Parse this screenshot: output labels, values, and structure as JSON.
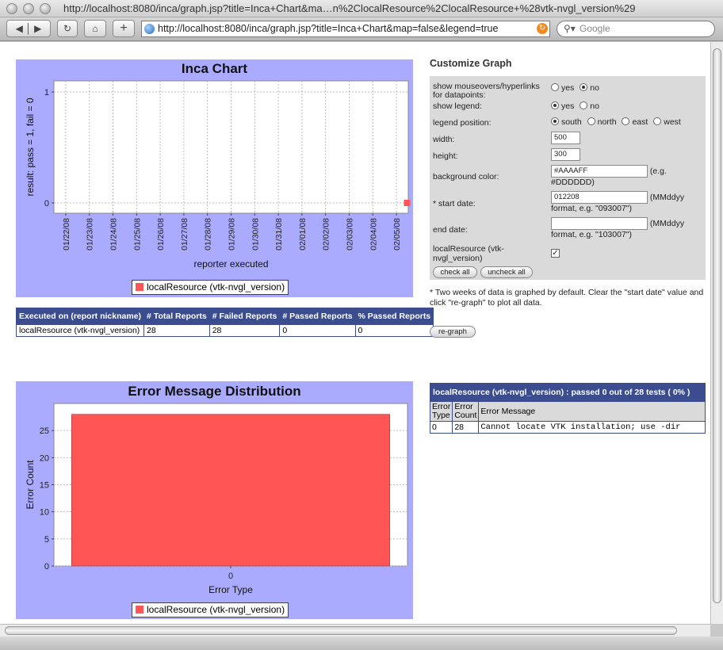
{
  "window": {
    "title": "http://localhost:8080/inca/graph.jsp?title=Inca+Chart&ma…n%2ClocalResource%2ClocalResource+%28vtk-nvgl_version%29",
    "url": "http://localhost:8080/inca/graph.jsp?title=Inca+Chart&map=false&legend=true",
    "search_placeholder": "Google"
  },
  "inca_chart": {
    "title": "Inca Chart",
    "legend": "localResource (vtk-nvgl_version)",
    "chart_data": {
      "type": "scatter",
      "title": "Inca Chart",
      "xlabel": "reporter executed",
      "ylabel": "result: pass = 1, fail = 0",
      "x_ticks": [
        "01/22/08",
        "01/23/08",
        "01/24/08",
        "01/25/08",
        "01/26/08",
        "01/27/08",
        "01/28/08",
        "01/29/08",
        "01/30/08",
        "01/31/08",
        "02/01/08",
        "02/02/08",
        "02/03/08",
        "02/04/08",
        "02/05/08"
      ],
      "y_ticks": [
        "0",
        "1"
      ],
      "ylim": [
        0,
        1
      ],
      "series": [
        {
          "name": "localResource (vtk-nvgl_version)",
          "x": [
            "02/05/08"
          ],
          "y": [
            0
          ]
        }
      ],
      "color": "#ff5555",
      "grid": true,
      "legend_position": "bottom"
    }
  },
  "summary": {
    "headers": [
      "Executed on (report nickname)",
      "# Total Reports",
      "# Failed Reports",
      "# Passed Reports",
      "% Passed Reports"
    ],
    "row": [
      "localResource (vtk-nvgl_version)",
      "28",
      "28",
      "0",
      "0"
    ]
  },
  "error_chart": {
    "title": "Error Message Distribution",
    "legend": "localResource (vtk-nvgl_version)",
    "chart_data": {
      "type": "bar",
      "title": "Error Message Distribution",
      "categories": [
        "0"
      ],
      "values": [
        28
      ],
      "xlabel": "Error Type",
      "ylabel": "Error Count",
      "y_ticks": [
        "0",
        "5",
        "10",
        "15",
        "20",
        "25"
      ],
      "ylim": [
        0,
        30
      ],
      "series": [
        {
          "name": "localResource (vtk-nvgl_version)",
          "values": [
            28
          ]
        }
      ],
      "color": "#ff5555",
      "grid": true,
      "legend_position": "bottom"
    }
  },
  "customize": {
    "heading": "Customize Graph",
    "mouseovers_label": "show mouseovers/hyperlinks for datapoints:",
    "legend_label": "show legend:",
    "legend_position_label": "legend position:",
    "width_label": "width:",
    "height_label": "height:",
    "bgcolor_label": "background color:",
    "start_label": "* start date:",
    "end_label": "end date:",
    "series_label": "localResource (vtk-nvgl_version)",
    "yes": "yes",
    "no": "no",
    "positions": [
      "south",
      "north",
      "east",
      "west"
    ],
    "width_value": "500",
    "height_value": "300",
    "bgcolor_value": "#AAAAFF",
    "bgcolor_hint": "(e.g. #DDDDDD)",
    "start_value": "012208",
    "start_hint": "(MMddyy format, e.g. \"093007\")",
    "end_value": "",
    "end_hint": "(MMddyy format, e.g. \"103007\")",
    "check_all": "check all",
    "uncheck_all": "uncheck all",
    "note": "* Two weeks of data is graphed by default. Clear the \"start date\" value and click \"re-graph\" to plot all data.",
    "regraph": "re-graph"
  },
  "error_table": {
    "header": "localResource (vtk-nvgl_version) : passed 0 out of 28 tests ( 0% )",
    "col1": "Error Type",
    "col2": "Error Count",
    "col3": "Error Message",
    "row": [
      "0",
      "28",
      "Cannot locate VTK installation; use -dir"
    ]
  }
}
